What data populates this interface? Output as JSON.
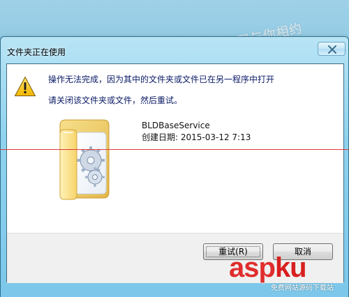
{
  "window": {
    "title": "文件夹正在使用",
    "close_icon": "close-icon"
  },
  "dialog": {
    "message": "操作无法完成，因为其中的文件夹或文件已在另一程序中打开",
    "hint": "请关闭该文件夹或文件，然后重试。",
    "item": {
      "name": "BLDBaseService",
      "created": "创建日期: 2015-03-12 7:13",
      "icon": "folder-gears-icon"
    },
    "warning_icon": "warning-icon",
    "buttons": {
      "retry": "重试(R)",
      "cancel": "取消"
    }
  },
  "watermarks": {
    "top": "天燃网与你相约",
    "bottom_asp": "asp",
    "bottom_ku": "ku",
    "bottom_sub": "免费网站源码下载站"
  },
  "colors": {
    "accent_title": "#0b1b66",
    "red_line": "#e03b3b",
    "watermark_red": "#e02d2d"
  }
}
